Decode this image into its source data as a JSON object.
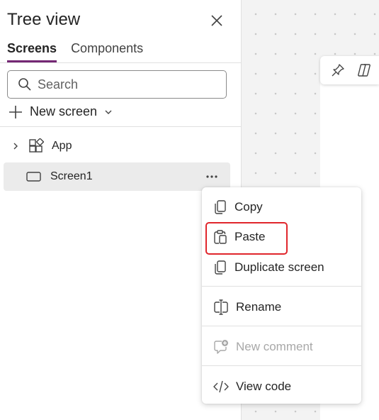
{
  "panel": {
    "title": "Tree view",
    "tabs": [
      {
        "label": "Screens",
        "active": true
      },
      {
        "label": "Components",
        "active": false
      }
    ],
    "search": {
      "placeholder": "Search",
      "value": ""
    },
    "new_screen_label": "New screen",
    "tree": [
      {
        "label": "App",
        "icon": "app-icon",
        "selected": false
      },
      {
        "label": "Screen1",
        "icon": "screen-icon",
        "selected": true
      }
    ]
  },
  "toolbar": {
    "pin_icon": "pin-icon",
    "copilot_icon": "copilot-icon"
  },
  "context_menu": {
    "items": [
      {
        "label": "Copy",
        "icon": "copy-icon",
        "disabled": false
      },
      {
        "label": "Paste",
        "icon": "paste-icon",
        "disabled": false,
        "highlighted": true
      },
      {
        "label": "Duplicate screen",
        "icon": "duplicate-icon",
        "disabled": false
      },
      {
        "label": "Rename",
        "icon": "rename-icon",
        "disabled": false
      },
      {
        "label": "New comment",
        "icon": "comment-icon",
        "disabled": true
      },
      {
        "label": "View code",
        "icon": "code-icon",
        "disabled": false
      }
    ]
  },
  "colors": {
    "accent": "#742774",
    "highlight_border": "#e0262c",
    "selected_row": "#ebebeb"
  }
}
